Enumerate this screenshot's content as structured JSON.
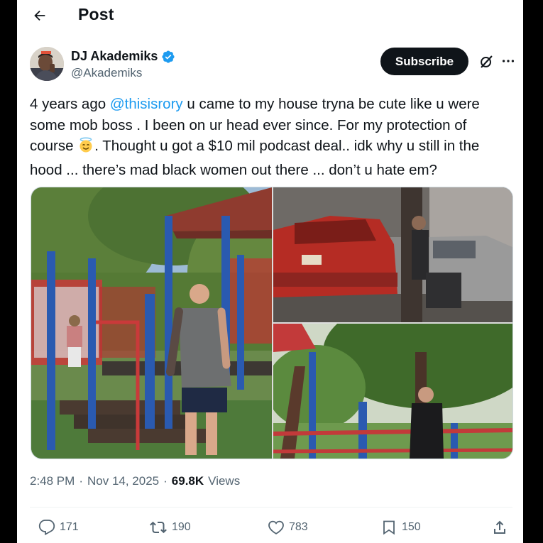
{
  "topbar": {
    "title": "Post"
  },
  "author": {
    "display_name": "DJ Akademiks",
    "handle": "@Akademiks",
    "verified": true,
    "subscribe_label": "Subscribe"
  },
  "post": {
    "text_part1": "4 years ago ",
    "mention": "@thisisrory",
    "text_part2": " u came to my house tryna be cute like u were some mob boss . I been on ur head ever since. For my protection of course ",
    "emoji_name": "smiling-face-with-halo",
    "text_part3": ".  Thought u got a $10 mil podcast deal.. idk why u still in the hood ... there’s mad black women out there ... don’t u hate em?"
  },
  "media": {
    "photos": [
      {
        "name": "playground-photo-man-climbing"
      },
      {
        "name": "street-photo-red-car"
      },
      {
        "name": "park-photo-man-standing"
      }
    ]
  },
  "meta": {
    "time": "2:48 PM",
    "separator": "·",
    "date": "Nov 14, 2025",
    "views_count": "69.8K",
    "views_label": "Views"
  },
  "actions": {
    "replies": "171",
    "reposts": "190",
    "likes": "783",
    "bookmarks": "150"
  },
  "colors": {
    "accent": "#1d9bf0",
    "text": "#0f1419",
    "secondary": "#536471",
    "button_bg": "#0f1419"
  }
}
